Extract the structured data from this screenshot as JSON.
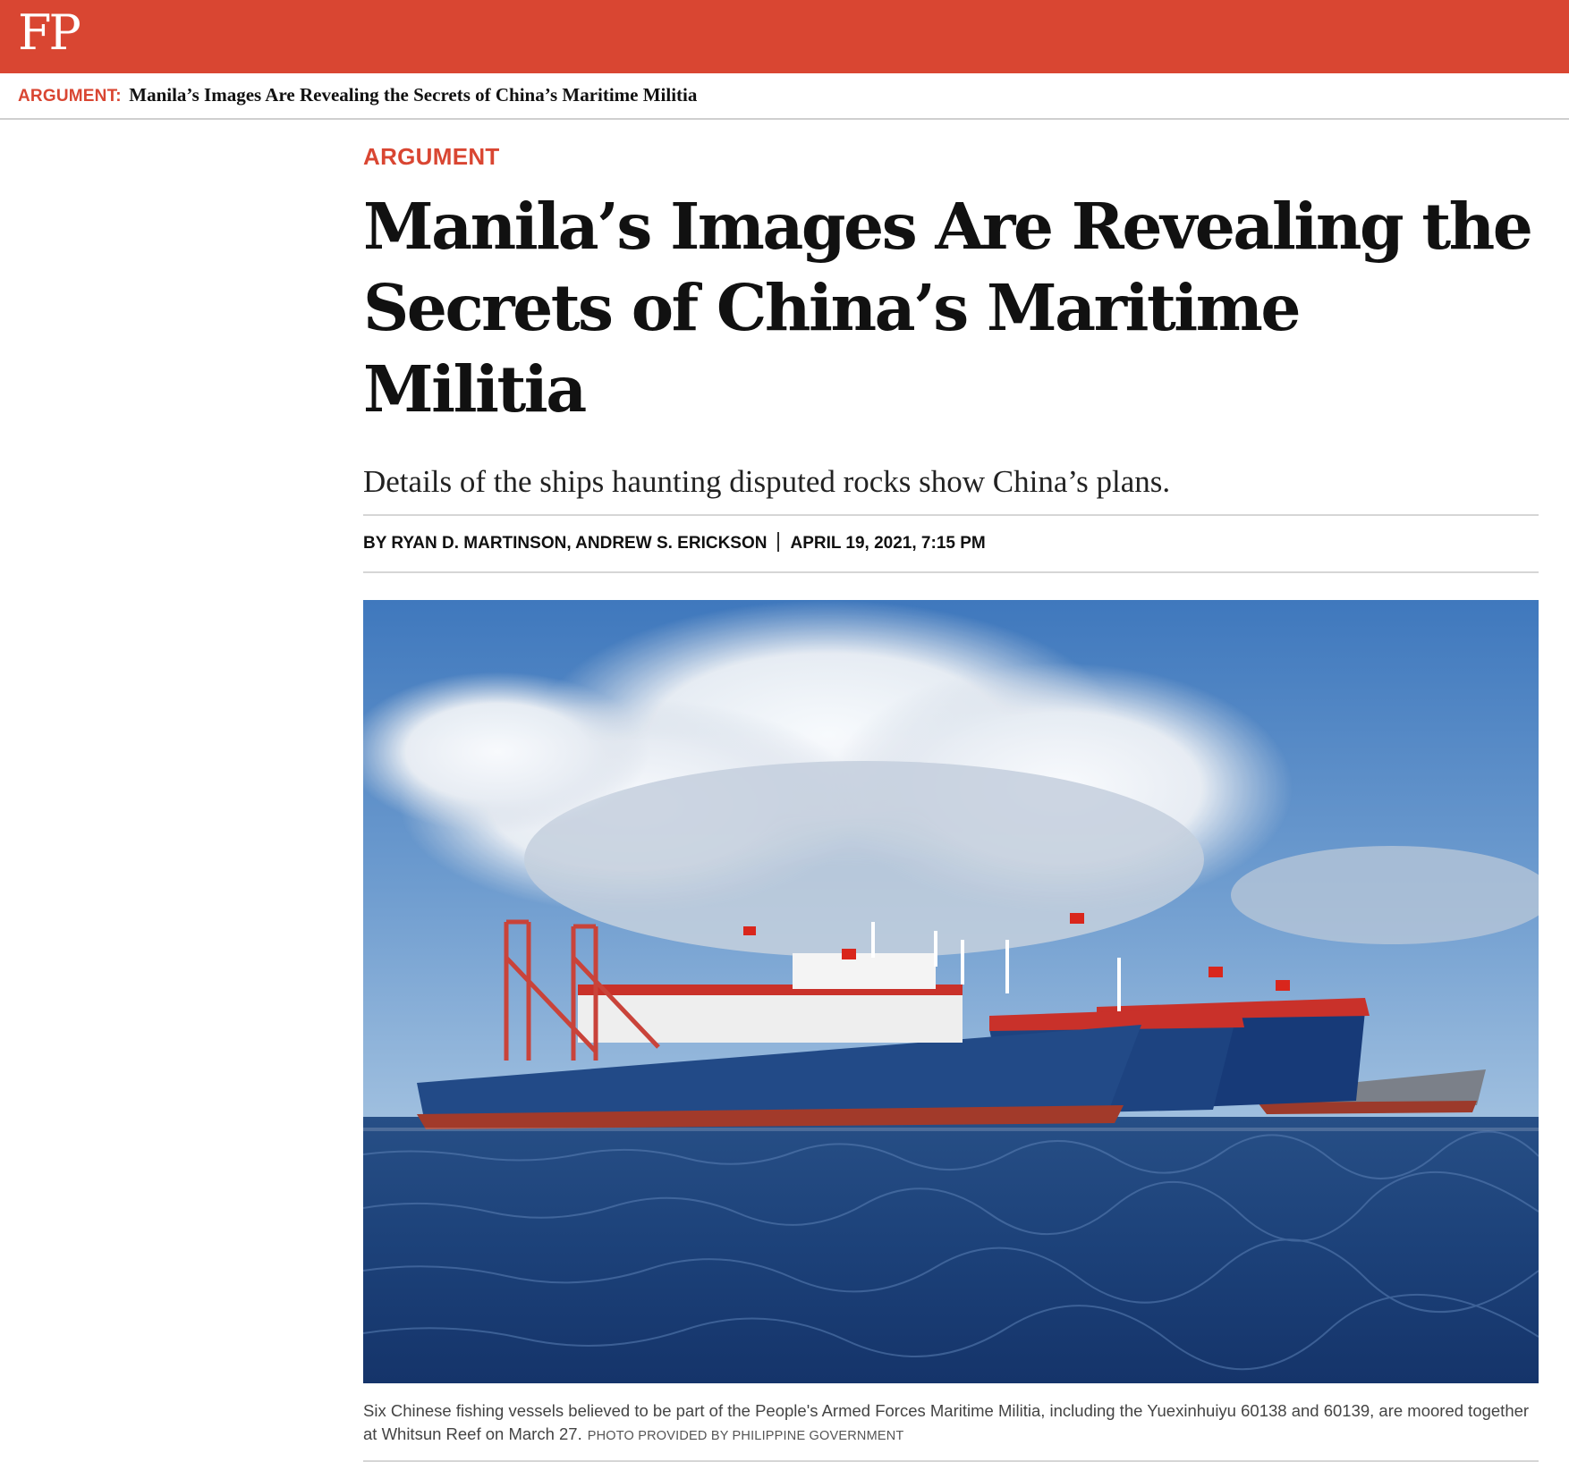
{
  "site": {
    "logo_text": "FP"
  },
  "breadcrumb": {
    "kicker": "ARGUMENT:",
    "title": "Manila’s Images Are Revealing the Secrets of China’s Maritime Militia"
  },
  "article": {
    "kicker": "ARGUMENT",
    "headline_line1": "Manila’s Images Are Revealing the",
    "headline_line2": "Secrets of China’s Maritime Militia",
    "dek": "Details of the ships haunting disputed rocks show China’s plans.",
    "byline_authors": "BY RYAN D. MARTINSON, ANDREW S. ERICKSON",
    "byline_date": "APRIL 19, 2021, 7:15 PM",
    "photo": {
      "description_icon": "photo-of-moored-fishing-vessels"
    },
    "caption": "Six Chinese fishing vessels believed to be part of the People's Armed Forces Maritime Militia, including the Yuexinhuiyu 60138 and 60139, are moored together at Whitsun Reef on March 27.",
    "photo_credit": "PHOTO PROVIDED BY PHILIPPINE GOVERNMENT"
  },
  "colors": {
    "brand_red": "#d94632",
    "text": "#111111",
    "rule": "#d6d6d6"
  }
}
